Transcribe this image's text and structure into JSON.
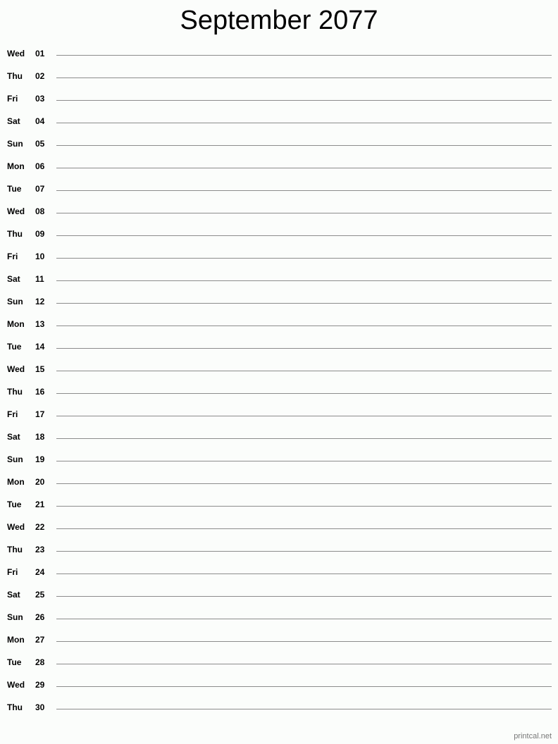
{
  "title": "September 2077",
  "days": [
    {
      "dow": "Wed",
      "num": "01"
    },
    {
      "dow": "Thu",
      "num": "02"
    },
    {
      "dow": "Fri",
      "num": "03"
    },
    {
      "dow": "Sat",
      "num": "04"
    },
    {
      "dow": "Sun",
      "num": "05"
    },
    {
      "dow": "Mon",
      "num": "06"
    },
    {
      "dow": "Tue",
      "num": "07"
    },
    {
      "dow": "Wed",
      "num": "08"
    },
    {
      "dow": "Thu",
      "num": "09"
    },
    {
      "dow": "Fri",
      "num": "10"
    },
    {
      "dow": "Sat",
      "num": "11"
    },
    {
      "dow": "Sun",
      "num": "12"
    },
    {
      "dow": "Mon",
      "num": "13"
    },
    {
      "dow": "Tue",
      "num": "14"
    },
    {
      "dow": "Wed",
      "num": "15"
    },
    {
      "dow": "Thu",
      "num": "16"
    },
    {
      "dow": "Fri",
      "num": "17"
    },
    {
      "dow": "Sat",
      "num": "18"
    },
    {
      "dow": "Sun",
      "num": "19"
    },
    {
      "dow": "Mon",
      "num": "20"
    },
    {
      "dow": "Tue",
      "num": "21"
    },
    {
      "dow": "Wed",
      "num": "22"
    },
    {
      "dow": "Thu",
      "num": "23"
    },
    {
      "dow": "Fri",
      "num": "24"
    },
    {
      "dow": "Sat",
      "num": "25"
    },
    {
      "dow": "Sun",
      "num": "26"
    },
    {
      "dow": "Mon",
      "num": "27"
    },
    {
      "dow": "Tue",
      "num": "28"
    },
    {
      "dow": "Wed",
      "num": "29"
    },
    {
      "dow": "Thu",
      "num": "30"
    }
  ],
  "footer": "printcal.net"
}
